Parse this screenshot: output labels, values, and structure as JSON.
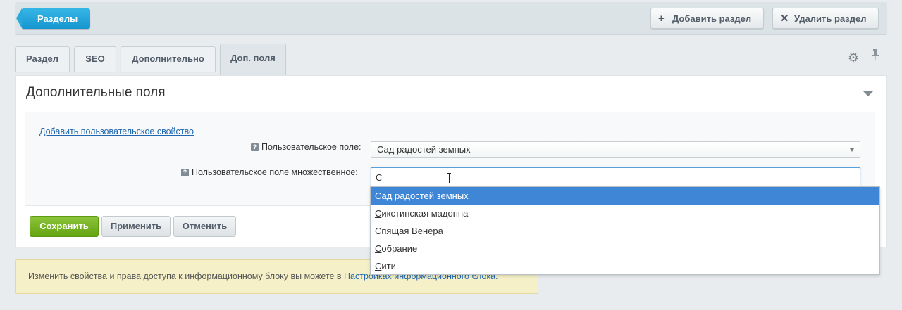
{
  "toolbar": {
    "sections_label": "Разделы",
    "add_section_label": "Добавить раздел",
    "delete_section_label": "Удалить раздел"
  },
  "tabs": [
    {
      "label": "Раздел"
    },
    {
      "label": "SEO"
    },
    {
      "label": "Дополнительно"
    },
    {
      "label": "Доп. поля"
    }
  ],
  "panel": {
    "title": "Дополнительные поля",
    "add_property_link": "Добавить пользовательское свойство",
    "field1": {
      "label": "Пользовательское поле:",
      "value": "Сад радостей земных"
    },
    "field2": {
      "label": "Пользовательское поле множественное:",
      "value": "С"
    }
  },
  "buttons": {
    "save": "Сохранить",
    "apply": "Применить",
    "cancel": "Отменить"
  },
  "notice": {
    "text": "Изменить свойства и права доступа к информационному блоку вы можете в ",
    "link": "Настройках информационного блока."
  },
  "dropdown": {
    "highlight_prefix": "С",
    "items": [
      {
        "label": "ад радостей земных"
      },
      {
        "label": "икстинская мадонна"
      },
      {
        "label": "пящая Венера"
      },
      {
        "label": "обрание"
      },
      {
        "label": "ити"
      }
    ]
  },
  "colors": {
    "accent_blue": "#1596cf",
    "save_green": "#64a412",
    "dropdown_highlight": "#3f86d7"
  },
  "icons": {
    "add": "plus-icon",
    "delete": "close-icon",
    "settings": "gear-icon",
    "pin": "pin-icon",
    "help": "help-icon",
    "collapse": "triangle-down-icon"
  }
}
